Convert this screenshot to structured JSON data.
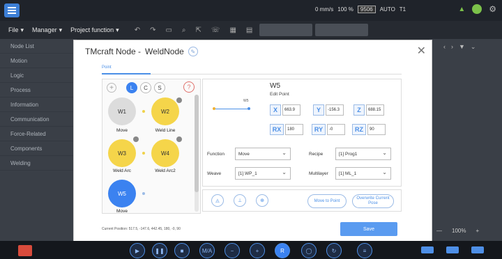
{
  "topbar": {
    "speed": "0 mm/s",
    "percent": "100 %",
    "code": "9506",
    "mode": "AUTO",
    "t": "T1"
  },
  "menubar": {
    "file": "File",
    "manager": "Manager",
    "project_function": "Project function",
    "dropdown1": "",
    "dropdown2": ""
  },
  "left_panel": {
    "items": [
      "Node List",
      "Motion",
      "Logic",
      "Process",
      "Information",
      "Communication",
      "Force-Related",
      "Components",
      "Welding"
    ]
  },
  "right_panel": {
    "zoom": "100%"
  },
  "dialog": {
    "title": "TMcraft Node -",
    "node_name": "WeldNode",
    "tabs": [
      "Point",
      "",
      "",
      "",
      ""
    ],
    "lcs": [
      "L",
      "C",
      "S"
    ],
    "nodes": [
      {
        "id": "W1",
        "label": "Move",
        "color": "#dcdcdc"
      },
      {
        "id": "W2",
        "label": "Weld Line",
        "color": "#f5d54a"
      },
      {
        "id": "W3",
        "label": "Weld Arc",
        "color": "#f5d54a"
      },
      {
        "id": "W4",
        "label": "Weld Arc2",
        "color": "#f5d54a"
      },
      {
        "id": "W5",
        "label": "Move",
        "color": "#3b82f0"
      }
    ],
    "point": {
      "name": "W5",
      "sub": "Edit Point",
      "mark": "W5",
      "coords": [
        {
          "label": "X",
          "value": "663.9"
        },
        {
          "label": "Y",
          "value": "-156.3"
        },
        {
          "label": "Z",
          "value": "688.15"
        },
        {
          "label": "RX",
          "value": "180"
        },
        {
          "label": "RY",
          "value": "-0"
        },
        {
          "label": "RZ",
          "value": "90"
        }
      ]
    },
    "function_label": "Function",
    "function_value": "Move",
    "recipe_label": "Recipe",
    "recipe_value": "[1] Prog1",
    "weave_label": "Weave",
    "weave_value": "[1] WP_1",
    "multilayer_label": "Multilayer",
    "multilayer_value": "[1] ML_1",
    "move_to_point": "Move to Point",
    "overwrite": "Overwrite Current Pose",
    "current_position": "Current Position: 517.5, -147.6, 442.45, 180, -0, 90",
    "save": "Save"
  },
  "bottombar": {
    "r_label": "R"
  }
}
